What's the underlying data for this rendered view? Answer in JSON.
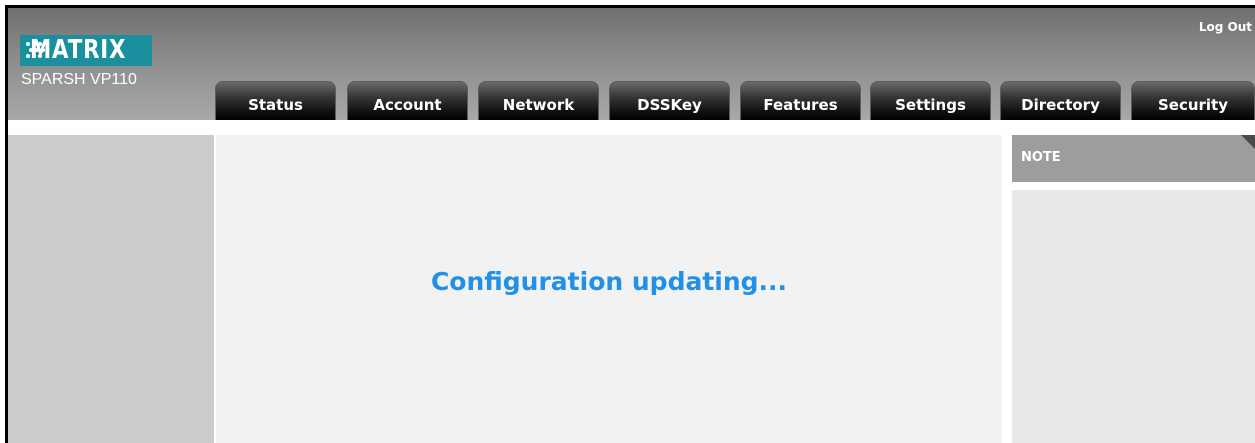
{
  "header": {
    "brand": "MATRIX",
    "model": "SPARSH VP110",
    "logout_label": "Log Out"
  },
  "nav": {
    "tabs": [
      {
        "label": "Status"
      },
      {
        "label": "Account"
      },
      {
        "label": "Network"
      },
      {
        "label": "DSSKey"
      },
      {
        "label": "Features"
      },
      {
        "label": "Settings"
      },
      {
        "label": "Directory"
      },
      {
        "label": "Security"
      }
    ]
  },
  "main": {
    "message": "Configuration updating..."
  },
  "note": {
    "title": "NOTE"
  },
  "colors": {
    "brand_teal": "#1a8f9e",
    "message_blue": "#2190e8",
    "tab_black": "#000000",
    "note_header_gray": "#9d9d9d"
  },
  "icons": {
    "brand_logo": "matrix-dots-logo-icon"
  }
}
